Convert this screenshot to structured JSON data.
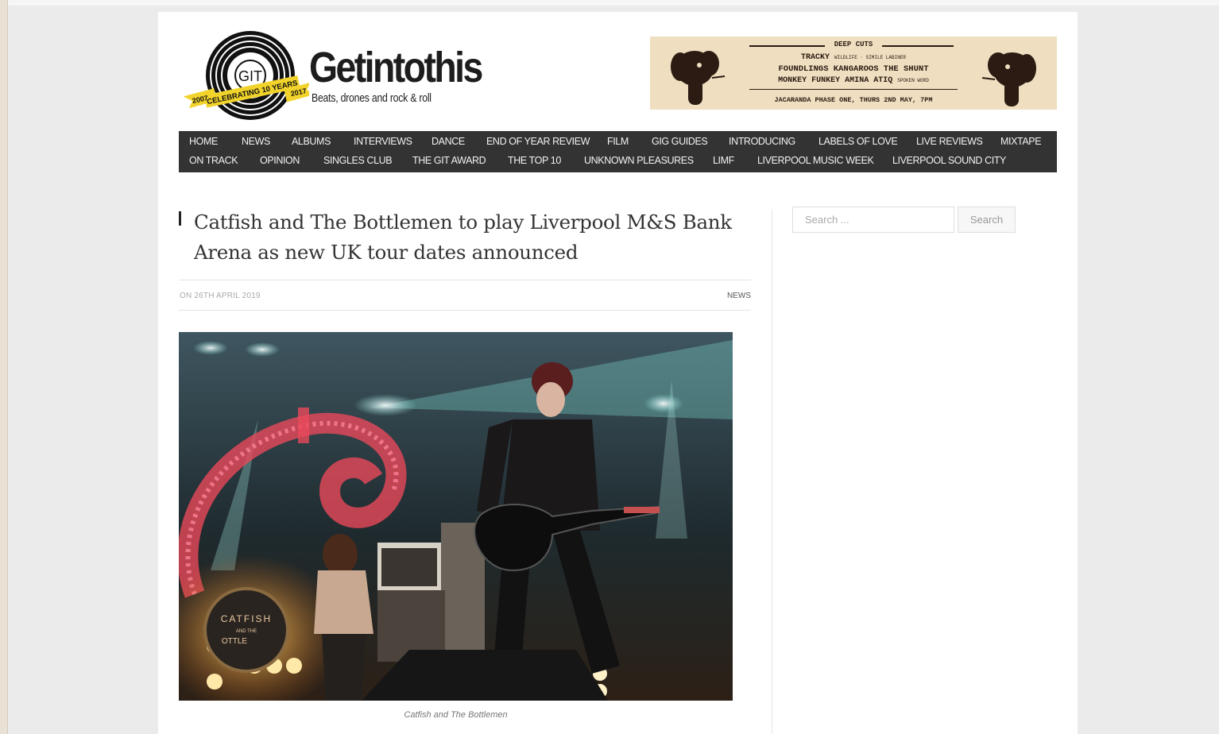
{
  "site": {
    "name": "Getintothis",
    "tagline": "Beats, drones and rock & roll",
    "logo": {
      "initials": "GIT",
      "ribbon": "CELEBRATING 10 YEARS",
      "year_start": "2007",
      "year_end": "2017"
    }
  },
  "banner": {
    "header": "DEEP CUTS",
    "line1_main": "TRACKY",
    "line1_support": "WILDLIFE · SIMILE LABINER",
    "line2": "FOUNDLINGS  KANGAROOS  THE SHUNT",
    "line3_main": "MONKEY FUNKEY  AMINA ATIQ",
    "line3_support": "SPOKEN WORD",
    "footer": "JACARANDA PHASE ONE, THURS 2ND MAY, 7PM"
  },
  "nav": {
    "row1": [
      "HOME",
      "NEWS",
      "ALBUMS",
      "INTERVIEWS",
      "DANCE",
      "END OF YEAR REVIEW",
      "FILM",
      "GIG GUIDES",
      "INTRODUCING",
      "LABELS OF LOVE",
      "LIVE REVIEWS",
      "MIXTAPE"
    ],
    "row2": [
      "ON TRACK",
      "OPINION",
      "SINGLES CLUB",
      "THE GIT AWARD",
      "THE TOP 10",
      "UNKNOWN PLEASURES",
      "LIMF",
      "LIVERPOOL MUSIC WEEK",
      "LIVERPOOL SOUND CITY"
    ]
  },
  "article": {
    "title": "Catfish and The Bottlemen to play Liverpool M&S Bank Arena as new UK tour dates announced",
    "date": "ON 26TH APRIL 2019",
    "category": "NEWS",
    "image_caption": "Catfish and The Bottlemen",
    "stage_text": "CATFISH",
    "stage_text2": "AND THE",
    "stage_text3": "OTTLE"
  },
  "sidebar": {
    "search_placeholder": "Search ...",
    "search_button": "Search"
  },
  "colors": {
    "page_background": "#ebebeb",
    "nav_background": "#333333",
    "logo_ribbon": "#f2d32b"
  }
}
